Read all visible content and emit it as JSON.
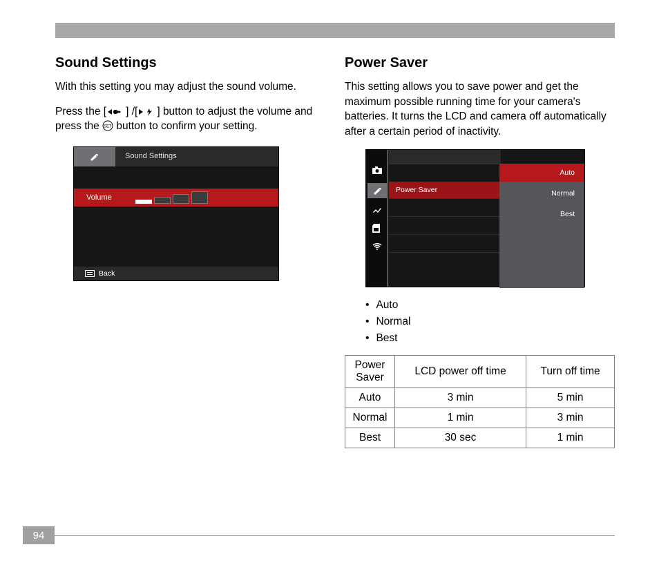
{
  "page_number": "94",
  "left": {
    "heading": "Sound Settings",
    "para1": "With this setting you may adjust the sound volume.",
    "para2_a": "Press the [",
    "para2_b": "] /[",
    "para2_c": "] button to adjust the volume and press the ",
    "para2_d": " button to confirm your setting.",
    "screen": {
      "tab_title": "Sound Settings",
      "volume_label": "Volume",
      "back_label": "Back"
    }
  },
  "right": {
    "heading": "Power Saver",
    "para": "This setting allows you to save power and get the maximum possible running time for your camera's batteries. It turns the LCD and camera off automatically after a certain period of inactivity.",
    "screen": {
      "row_label": "Power Saver",
      "options": [
        "Auto",
        "Normal",
        "Best"
      ]
    },
    "bullets": [
      "Auto",
      "Normal",
      "Best"
    ],
    "table": {
      "headers": [
        "Power Saver",
        "LCD power off time",
        "Turn off time"
      ],
      "rows": [
        [
          "Auto",
          "3 min",
          "5 min"
        ],
        [
          "Normal",
          "1 min",
          "3 min"
        ],
        [
          "Best",
          "30 sec",
          "1 min"
        ]
      ]
    }
  }
}
